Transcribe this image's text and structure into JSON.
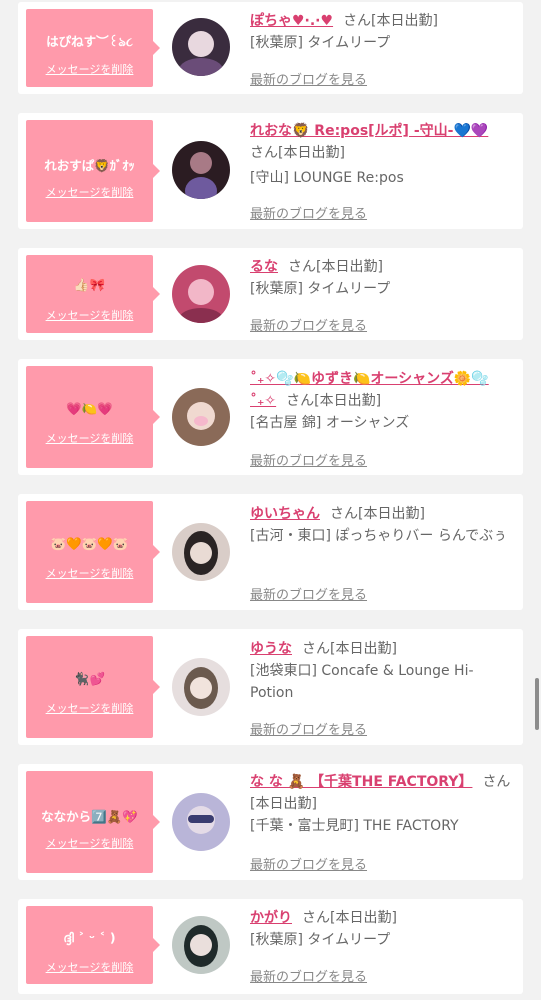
{
  "delete_label": "メッセージを削除",
  "blog_label": "最新のブログを見る",
  "entries": [
    {
      "message": "はぴねす︶꒰ঌ૮",
      "name": "ぽちゃ♥︎·.·♥︎",
      "san_status": "さん[本日出勤]",
      "shop": "[秋葉原] タイムリープ",
      "avatar_colors": [
        "#3a2c3e",
        "#e8d8df"
      ]
    },
    {
      "message": "れおすぱ🦁ｶﾞｵｯ",
      "name": "れおな🦁 Re:pos[ルポ] -守山-💙💜",
      "san_status": "さん[本日出勤]",
      "shop": "[守山] LOUNGE Re:pos",
      "avatar_colors": [
        "#2b1c22",
        "#a87a86"
      ]
    },
    {
      "message": "👍🏻🎀",
      "name": "るな",
      "san_status": "さん[本日出勤]",
      "shop": "[秋葉原] タイムリープ",
      "avatar_colors": [
        "#c24a6e",
        "#f2b7c8"
      ]
    },
    {
      "message": "💗🍋💗",
      "name": "˚₊✧🫧🍋ゆずき🍋オーシャンズ🌼🫧˚₊✧",
      "san_status": "さん[本日出勤]",
      "shop": "[名古屋 錦] オーシャンズ",
      "avatar_colors": [
        "#8a6a58",
        "#f0d9d0"
      ]
    },
    {
      "message": "🐷🧡🐷🧡🐷",
      "name": "ゆいちゃん",
      "san_status": "さん[本日出勤]",
      "shop": "[古河・東口] ぽっちゃりバー らんでぶぅ",
      "avatar_colors": [
        "#2a2424",
        "#d9cdc8"
      ]
    },
    {
      "message": "🐈‍⬛💕",
      "name": "ゆうな",
      "san_status": "さん[本日出勤]",
      "shop": "[池袋東口] Concafe & Lounge Hi-Potion",
      "avatar_colors": [
        "#6b5a4e",
        "#e6dede"
      ]
    },
    {
      "message": "ななから7️⃣🧸💖",
      "name": "な な 🧸 【千葉THE FACTORY】",
      "san_status": "さん[本日出勤]",
      "shop": "[千葉・富士見町] THE FACTORY",
      "avatar_colors": [
        "#3a3c70",
        "#b9b5d8"
      ]
    },
    {
      "message": "ദ്ദി ˃ ᵕ ˂ )",
      "name": "かがり",
      "san_status": "さん[本日出勤]",
      "shop": "[秋葉原] タイムリープ",
      "avatar_colors": [
        "#1f2a2a",
        "#bfc8c4"
      ]
    }
  ]
}
